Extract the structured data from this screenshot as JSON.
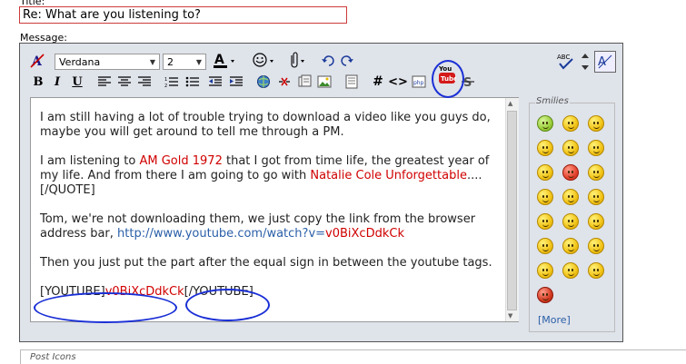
{
  "title_label": "Title:",
  "title_value": "Re: What are you listening to?",
  "message_label": "Message:",
  "toolbar": {
    "font_name": "Verdana",
    "font_size": "2",
    "icons": [
      "remove-format-icon",
      "font-color-icon",
      "smilies-icon",
      "attachment-icon",
      "undo-icon",
      "redo-icon",
      "spellcheck-icon",
      "resize-icon",
      "switch-mode-icon",
      "bold-icon",
      "italic-icon",
      "underline-icon",
      "align-left-icon",
      "align-center-icon",
      "align-right-icon",
      "ordered-list-icon",
      "unordered-list-icon",
      "outdent-icon",
      "indent-icon",
      "insert-link-icon",
      "remove-link-icon",
      "insert-email-icon",
      "insert-image-icon",
      "quote-icon",
      "code-icon",
      "html-icon",
      "php-icon",
      "youtube-icon",
      "strikethrough-icon"
    ],
    "youtube_label": "You Tube"
  },
  "message": {
    "p1": "I am still having a lot of trouble trying to download a video like you guys do, maybe you will get around to tell me through a PM.",
    "p2_a": "I am listening to ",
    "p2_red1": "AM Gold 1972",
    "p2_b": " that I got from time life, the greatest year of my life. And from there I am going to go with ",
    "p2_red2": "Natalie Cole Unforgettable",
    "p2_c": "....[/QUOTE]",
    "p3_a": "Tom, we're not downloading them, we just copy the link from the browser address bar, ",
    "p3_link": "http://www.youtube.com/watch?v=",
    "p3_red": "v0BiXcDdkCk",
    "p4": "Then you just put the part after the equal sign in between the youtube tags.",
    "p5_a": "[YOUTUBE]",
    "p5_red": "v0BiXcDdkCk",
    "p5_b": "[/YOUTUBE]"
  },
  "smilies": {
    "legend": "Smilies",
    "more": "[More]",
    "items": [
      "green",
      "yellow",
      "yellow",
      "yellow",
      "yellow",
      "yellow",
      "yellow",
      "red",
      "yellow",
      "yellow",
      "yellow",
      "yellow",
      "yellow",
      "yellow",
      "yellow",
      "yellow",
      "yellow",
      "yellow",
      "yellow",
      "yellow",
      "yellow",
      "devil"
    ]
  },
  "post_icons_label": "Post Icons"
}
